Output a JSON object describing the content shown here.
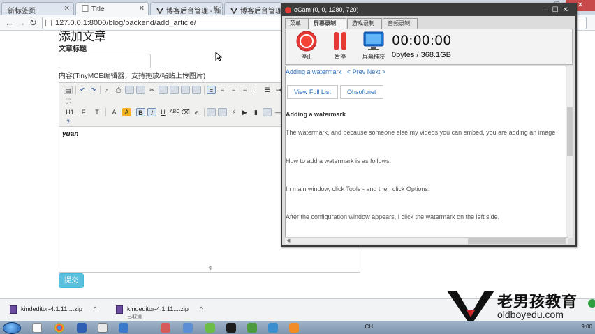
{
  "browser": {
    "tabs": [
      {
        "label": "新标签页",
        "active": false
      },
      {
        "label": "Title",
        "active": true
      },
      {
        "label": "博客后台管理 - 新",
        "active": false
      },
      {
        "label": "博客后台管理 - 新",
        "active": false
      }
    ],
    "url": "127.0.0.1:8000/blog/backend/add_article/"
  },
  "page": {
    "heading": "添加文章",
    "title_label": "文章标题",
    "content_label": "内容(TinyMCE编辑器，支持拖放/粘贴上传图片)",
    "editor_text": "yuan",
    "submit_label": "提交",
    "toolbar_glyphs": {
      "row2": [
        "H1",
        "F",
        "T",
        "A",
        "A",
        "B",
        "I",
        "U",
        "ABC"
      ]
    }
  },
  "ocam": {
    "title": "oCam (0, 0, 1280, 720)",
    "tabs": [
      "菜单",
      "屏幕录制",
      "游戏录制",
      "音频录制"
    ],
    "active_tab": "屏幕录制",
    "buttons": {
      "stop": "停止",
      "pause": "暂停",
      "capture": "屏幕捕获"
    },
    "timer": "00:00:00",
    "size": "0bytes / 368.1GB",
    "colors": {
      "stop": "#e53935",
      "pause": "#e53935",
      "capture": "#1976d2"
    },
    "content": {
      "top_link": "Adding a watermark",
      "prev_next": "< Prev Next >",
      "view_full_list": "View Full List",
      "site": "Ohsoft.net",
      "heading": "Adding a watermark",
      "paragraphs": [
        "The watermark, and because someone else my videos you can embed, you are adding an image",
        "How to add a watermark is as follows.",
        "In main window, click Tools - and then click Options.",
        "After the configuration window appears, I click the watermark on the left side."
      ]
    }
  },
  "downloads": [
    {
      "name": "kindeditor-4.1.11....zip",
      "status": ""
    },
    {
      "name": "kindeditor-4.1.11....zip",
      "status": "已取消"
    }
  ],
  "watermark": {
    "brand": "老男孩教育",
    "url": "oldboyedu.com"
  },
  "taskbar": {
    "lang": "CH",
    "time": "9:00"
  }
}
